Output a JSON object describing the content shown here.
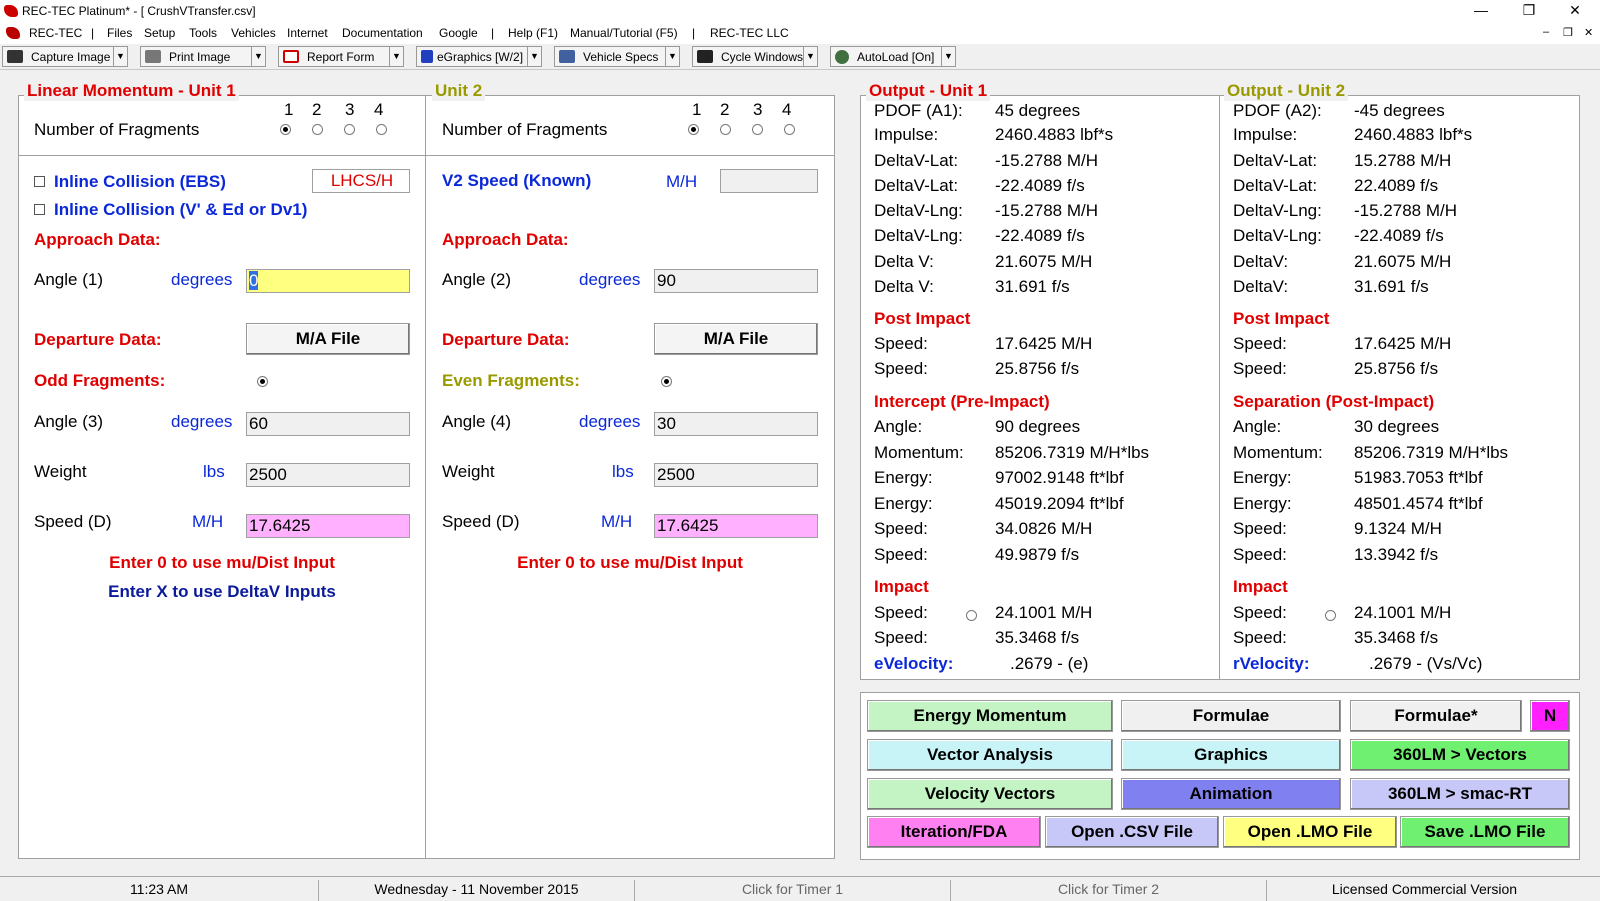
{
  "window": {
    "title": "REC-TEC Platinum* - [  CrushVTransfer.csv]",
    "min": "—",
    "max": "❐",
    "close": "✕",
    "mdi": [
      "–",
      "❐",
      "✕"
    ]
  },
  "menu": [
    "REC-TEC",
    "|",
    "Files",
    "Setup",
    "Tools",
    "Vehicles",
    "Internet",
    "Documentation",
    "Google",
    "|",
    "Help (F1)",
    "Manual/Tutorial (F5)",
    "|",
    "REC-TEC LLC"
  ],
  "toolbar": [
    {
      "label": "Capture Image",
      "icon": "camera-icon",
      "color": "#333333"
    },
    {
      "label": "Print Image",
      "icon": "printer-icon",
      "color": "#666666"
    },
    {
      "label": "Report Form",
      "icon": "report-icon",
      "color": "#c00000"
    },
    {
      "label": "eGraphics [W/2]",
      "icon": "graphics-icon",
      "color": "#2040c0"
    },
    {
      "label": "Vehicle Specs",
      "icon": "specs-icon",
      "color": "#4060a0"
    },
    {
      "label": "Cycle Windows",
      "icon": "binoculars-icon",
      "color": "#222222"
    },
    {
      "label": "AutoLoad [On]",
      "icon": "globe-icon",
      "color": "#407040"
    }
  ],
  "unit1": {
    "legend": "Linear Momentum - Unit 1",
    "frag_nums": [
      "1",
      "2",
      "3",
      "4"
    ],
    "fragments_label": "Number of Fragments",
    "inline_ebs": "Inline Collision (EBS)",
    "lhcs": "LHCS/H",
    "inline_v": "Inline Collision (V' & Ed or Dv1)",
    "approach": "Approach Data:",
    "angle1": "Angle (1)",
    "deg": "degrees",
    "angle1_val": "0",
    "departure": "Departure Data:",
    "ma_file": "M/A File",
    "odd": "Odd Fragments:",
    "angle3": "Angle (3)",
    "angle3_val": "60",
    "weight": "Weight",
    "lbs": "lbs",
    "weight_val": "2500",
    "speed": "Speed (D)",
    "mh": "M/H",
    "speed_val": "17.6425",
    "hint0": "Enter 0 to use mu/Dist Input",
    "hintx": "Enter X to use DeltaV Inputs"
  },
  "unit2": {
    "legend": "Unit 2",
    "frag_nums": [
      "1",
      "2",
      "3",
      "4"
    ],
    "fragments_label": "Number of Fragments",
    "v2": "V2 Speed (Known)",
    "mh": "M/H",
    "v2_val": "",
    "approach": "Approach Data:",
    "angle2": "Angle (2)",
    "deg": "degrees",
    "angle2_val": "90",
    "departure": "Departure Data:",
    "ma_file": "M/A File",
    "even": "Even Fragments:",
    "angle4": "Angle (4)",
    "angle4_val": "30",
    "weight": "Weight",
    "lbs": "lbs",
    "weight_val": "2500",
    "speed": "Speed (D)",
    "speed_val": "17.6425",
    "hint0": "Enter 0 to use mu/Dist Input"
  },
  "out1": {
    "legend": "Output - Unit 1",
    "rows": [
      [
        "PDOF (A1):",
        "45  degrees"
      ],
      [
        "Impulse:",
        "2460.4883  lbf*s"
      ],
      [
        "DeltaV-Lat:",
        "-15.2788  M/H"
      ],
      [
        "DeltaV-Lat:",
        "-22.4089  f/s"
      ],
      [
        "DeltaV-Lng:",
        "-15.2788  M/H"
      ],
      [
        "DeltaV-Lng:",
        "-22.4089  f/s"
      ],
      [
        "Delta V:",
        "21.6075  M/H"
      ],
      [
        "Delta V:",
        "31.691  f/s"
      ]
    ],
    "post": "Post Impact",
    "post_rows": [
      [
        "Speed:",
        "17.6425  M/H"
      ],
      [
        "Speed:",
        "25.8756  f/s"
      ]
    ],
    "section3": "Intercept (Pre-Impact)",
    "s3_rows": [
      [
        "Angle:",
        "90  degrees"
      ],
      [
        "Momentum:",
        "85206.7319  M/H*lbs"
      ],
      [
        "Energy:",
        "97002.9148  ft*lbf"
      ],
      [
        "Energy:",
        "45019.2094  ft*lbf"
      ],
      [
        "Speed:",
        "34.0826  M/H"
      ],
      [
        "Speed:",
        "49.9879  f/s"
      ]
    ],
    "impact": "Impact",
    "impact_rows": [
      [
        "Speed:",
        "24.1001  M/H"
      ],
      [
        "Speed:",
        "35.3468  f/s"
      ]
    ],
    "vel_label": "eVelocity:",
    "vel_val": ".2679  -  (e)"
  },
  "out2": {
    "legend": "Output - Unit 2",
    "rows": [
      [
        "PDOF (A2):",
        "-45  degrees"
      ],
      [
        "Impulse:",
        "2460.4883  lbf*s"
      ],
      [
        "DeltaV-Lat:",
        "15.2788  M/H"
      ],
      [
        "DeltaV-Lat:",
        "22.4089  f/s"
      ],
      [
        "DeltaV-Lng:",
        "-15.2788  M/H"
      ],
      [
        "DeltaV-Lng:",
        "-22.4089  f/s"
      ],
      [
        "DeltaV:",
        "21.6075  M/H"
      ],
      [
        "DeltaV:",
        "31.691  f/s"
      ]
    ],
    "post": "Post Impact",
    "post_rows": [
      [
        "Speed:",
        "17.6425  M/H"
      ],
      [
        "Speed:",
        "25.8756  f/s"
      ]
    ],
    "section3": "Separation (Post-Impact)",
    "s3_rows": [
      [
        "Angle:",
        "30  degrees"
      ],
      [
        "Momentum:",
        "85206.7319  M/H*lbs"
      ],
      [
        "Energy:",
        "51983.7053  ft*lbf"
      ],
      [
        "Energy:",
        "48501.4574  ft*lbf"
      ],
      [
        "Speed:",
        "9.1324  M/H"
      ],
      [
        "Speed:",
        "13.3942  f/s"
      ]
    ],
    "impact": "Impact",
    "impact_rows": [
      [
        "Speed:",
        "24.1001  M/H"
      ],
      [
        "Speed:",
        "35.3468  f/s"
      ]
    ],
    "vel_label": "rVelocity:",
    "vel_val": ".2679  -  (Vs/Vc)"
  },
  "buttons": {
    "energy": "Energy Momentum",
    "formulae": "Formulae",
    "formulae2": "Formulae*",
    "n": "N",
    "vector": "Vector Analysis",
    "graphics": "Graphics",
    "lm_vectors": "360LM > Vectors",
    "velocity": "Velocity Vectors",
    "animation": "Animation",
    "lm_smac": "360LM > smac-RT",
    "iteration": "Iteration/FDA",
    "open_csv": "Open .CSV File",
    "open_lmo": "Open .LMO File",
    "save_lmo": "Save .LMO File"
  },
  "status": {
    "time": "11:23 AM",
    "date": "Wednesday  -  11 November 2015",
    "timer1": "Click for Timer 1",
    "timer2": "Click for Timer 2",
    "license": "Licensed Commercial Version"
  }
}
